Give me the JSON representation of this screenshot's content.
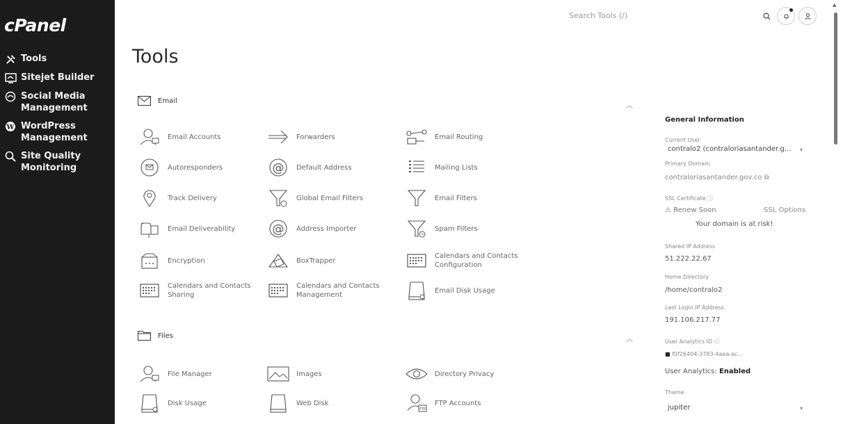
{
  "sidebar": {
    "logo": "cPanel",
    "items": [
      {
        "label": "Tools",
        "icon": "tools-icon"
      },
      {
        "label": "Sitejet Builder",
        "icon": "builder-icon"
      },
      {
        "label": "Social Media Management",
        "icon": "social-icon"
      },
      {
        "label": "WordPress Management",
        "icon": "wordpress-icon"
      },
      {
        "label": "Site Quality Monitoring",
        "icon": "quality-icon"
      }
    ]
  },
  "header": {
    "search_placeholder": "Search Tools (/)",
    "page_title": "Tools"
  },
  "sections": {
    "email": {
      "title": "Email",
      "tools": [
        {
          "label": "Email Accounts",
          "icon": "user-accounts-icon"
        },
        {
          "label": "Forwarders",
          "icon": "forward-arrow-icon"
        },
        {
          "label": "Email Routing",
          "icon": "routing-icon"
        },
        {
          "label": "Autoresponders",
          "icon": "autoresponder-icon"
        },
        {
          "label": "Default Address",
          "icon": "at-sign-icon"
        },
        {
          "label": "Mailing Lists",
          "icon": "list-icon"
        },
        {
          "label": "Track Delivery",
          "icon": "location-pin-icon"
        },
        {
          "label": "Global Email Filters",
          "icon": "funnel-globe-icon"
        },
        {
          "label": "Email Filters",
          "icon": "funnel-icon"
        },
        {
          "label": "Email Deliverability",
          "icon": "mailbox-icon"
        },
        {
          "label": "Address Importer",
          "icon": "at-sign-import-icon"
        },
        {
          "label": "Spam Filters",
          "icon": "funnel-clock-icon"
        },
        {
          "label": "Encryption",
          "icon": "encryption-icon"
        },
        {
          "label": "BoxTrapper",
          "icon": "boxtrapper-icon"
        },
        {
          "label": "Calendars and Contacts Configuration",
          "icon": "calendar-icon"
        },
        {
          "label": "Calendars and Contacts Sharing",
          "icon": "calendar-icon"
        },
        {
          "label": "Calendars and Contacts Management",
          "icon": "calendar-icon"
        },
        {
          "label": "Email Disk Usage",
          "icon": "disk-icon"
        }
      ]
    },
    "files": {
      "title": "Files",
      "tools": [
        {
          "label": "File Manager",
          "icon": "user-accounts-icon"
        },
        {
          "label": "Images",
          "icon": "images-icon"
        },
        {
          "label": "Directory Privacy",
          "icon": "eye-icon"
        },
        {
          "label": "Disk Usage",
          "icon": "disk-icon"
        },
        {
          "label": "Web Disk",
          "icon": "disk-icon"
        },
        {
          "label": "FTP Accounts",
          "icon": "ftp-user-icon"
        }
      ]
    }
  },
  "info": {
    "title": "General Information",
    "current_user_label": "Current User",
    "current_user_value": "contralo2 (contraloriasantander.g...",
    "primary_domain_label": "Primary Domain",
    "primary_domain_value": "contraloriasantander.gov.co",
    "ssl_label": "SSL Certificate",
    "ssl_status": "Renew Soon",
    "ssl_options": "SSL Options",
    "ssl_warning": "Your domain is at risk!",
    "shared_ip_label": "Shared IP Address",
    "shared_ip_value": "51.222.22.67",
    "home_dir_label": "Home Directory",
    "home_dir_value": "/home/contralo2",
    "last_login_label": "Last Login IP Address",
    "last_login_value": "191.106.217.77",
    "analytics_id_label": "User Analytics ID",
    "analytics_id_value": "f0f26404-3783-4aea-ac...",
    "analytics_label": "User Analytics:",
    "analytics_value": "Enabled",
    "theme_label": "Theme",
    "theme_value": "jupiter"
  },
  "colors": {
    "sidebar_bg": "#1b1b1b",
    "sidebar_text": "#f2f2f2",
    "icon_stroke": "#555555"
  }
}
